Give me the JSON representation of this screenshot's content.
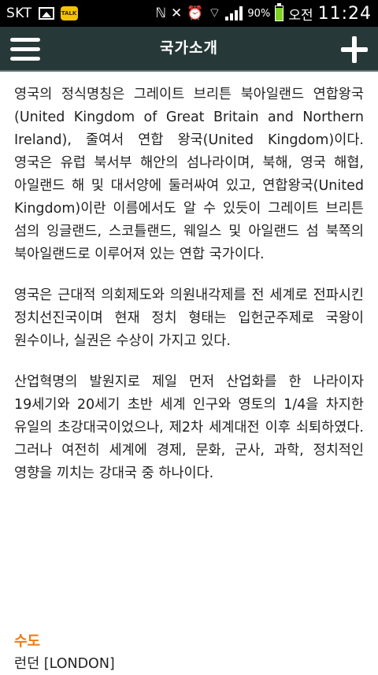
{
  "status_bar": {
    "carrier": "SKT",
    "talk_badge": "TALK",
    "battery_percent": "90%",
    "battery_level": 0.9,
    "ampm": "오전",
    "time": "11:24"
  },
  "header": {
    "title": "국가소개"
  },
  "paragraphs": [
    "영국의 정식명칭은 그레이트 브리튼 북아일랜드 연합왕국(United Kingdom of Great Britain and Northern Ireland), 줄여서 연합 왕국(United Kingdom)이다. 영국은 유럽 북서부 해안의 섬나라이며, 북해, 영국 해협, 아일랜드 해 및 대서양에 둘러싸여 있고, 연합왕국(United Kingdom)이란 이름에서도 알 수 있듯이 그레이트 브리튼 섬의 잉글랜드, 스코틀랜드, 웨일스 및 아일랜드 섬 북쪽의 북아일랜드로 이루어져 있는 연합 국가이다.",
    "영국은 근대적 의회제도와 의원내각제를 전 세계로 전파시킨 정치선진국이며 현재 정치 형태는 입헌군주제로 국왕이 원수이나, 실권은 수상이 가지고 있다.",
    "산업혁명의 발원지로 제일 먼저 산업화를 한 나라이자 19세기와 20세기 초반 세계 인구와 영토의 1/4을 차지한 유일의 초강대국이었으나, 제2차 세계대전 이후 쇠퇴하였다. 그러나 여전히 세계에 경제, 문화, 군사, 과학, 정치적인 영향을 끼치는 강대국 중 하나이다."
  ],
  "capital": {
    "heading": "수도",
    "value": "런던 [LONDON]"
  },
  "colors": {
    "title_bar": "#273839",
    "accent_heading": "#f07b12",
    "battery": "#7ed321"
  }
}
